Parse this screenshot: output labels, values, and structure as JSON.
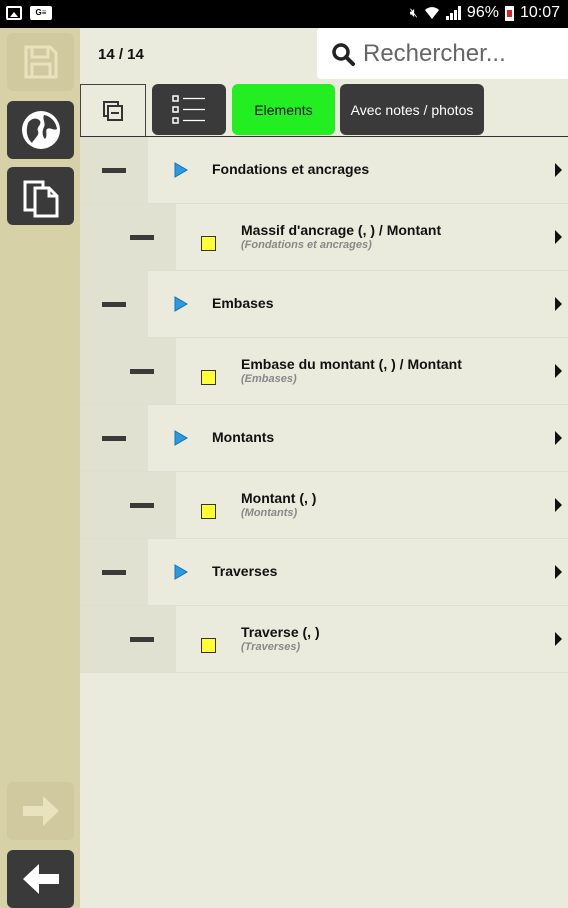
{
  "status_bar": {
    "battery": "96%",
    "time": "10:07",
    "card_label": "G≡",
    "icons": [
      "image-icon",
      "sim-card-icon",
      "mute-icon",
      "wifi-icon",
      "signal-icon",
      "battery-icon"
    ]
  },
  "header": {
    "counter": "14 / 14",
    "search": {
      "placeholder": "Rechercher...",
      "value": ""
    }
  },
  "sidebar": {
    "buttons": [
      {
        "name": "save-button",
        "icon": "floppy-disk-icon",
        "enabled": false
      },
      {
        "name": "globe-button",
        "icon": "globe-icon",
        "enabled": true
      },
      {
        "name": "copy-button",
        "icon": "copy-icon",
        "enabled": true
      },
      {
        "name": "next-button",
        "icon": "arrow-right-icon",
        "enabled": false
      },
      {
        "name": "back-button",
        "icon": "arrow-left-icon",
        "enabled": true
      }
    ]
  },
  "toolbar": {
    "collapse_icon": "collapse-all-icon",
    "list_icon": "list-icon",
    "elements_label": "Elements",
    "notes_label": "Avec notes / photos",
    "active_color": "#22ee22",
    "dark_color": "#3a3a3a"
  },
  "list": [
    {
      "type": "group",
      "title": "Fondations et ancrages"
    },
    {
      "type": "item",
      "title": "Massif d'ancrage (, ) / Montant",
      "subtitle": "(Fondations et ancrages)"
    },
    {
      "type": "group",
      "title": "Embases"
    },
    {
      "type": "item",
      "title": "Embase du montant (, ) / Montant",
      "subtitle": "(Embases)"
    },
    {
      "type": "group",
      "title": "Montants"
    },
    {
      "type": "item",
      "title": "Montant (, )",
      "subtitle": "(Montants)"
    },
    {
      "type": "group",
      "title": "Traverses"
    },
    {
      "type": "item",
      "title": "Traverse (, )",
      "subtitle": "(Traverses)"
    }
  ],
  "colors": {
    "background": "#ebebdd",
    "sidebar": "#d7d1a7",
    "group_marker": "#2a9be0",
    "item_marker": "#ffff33"
  }
}
